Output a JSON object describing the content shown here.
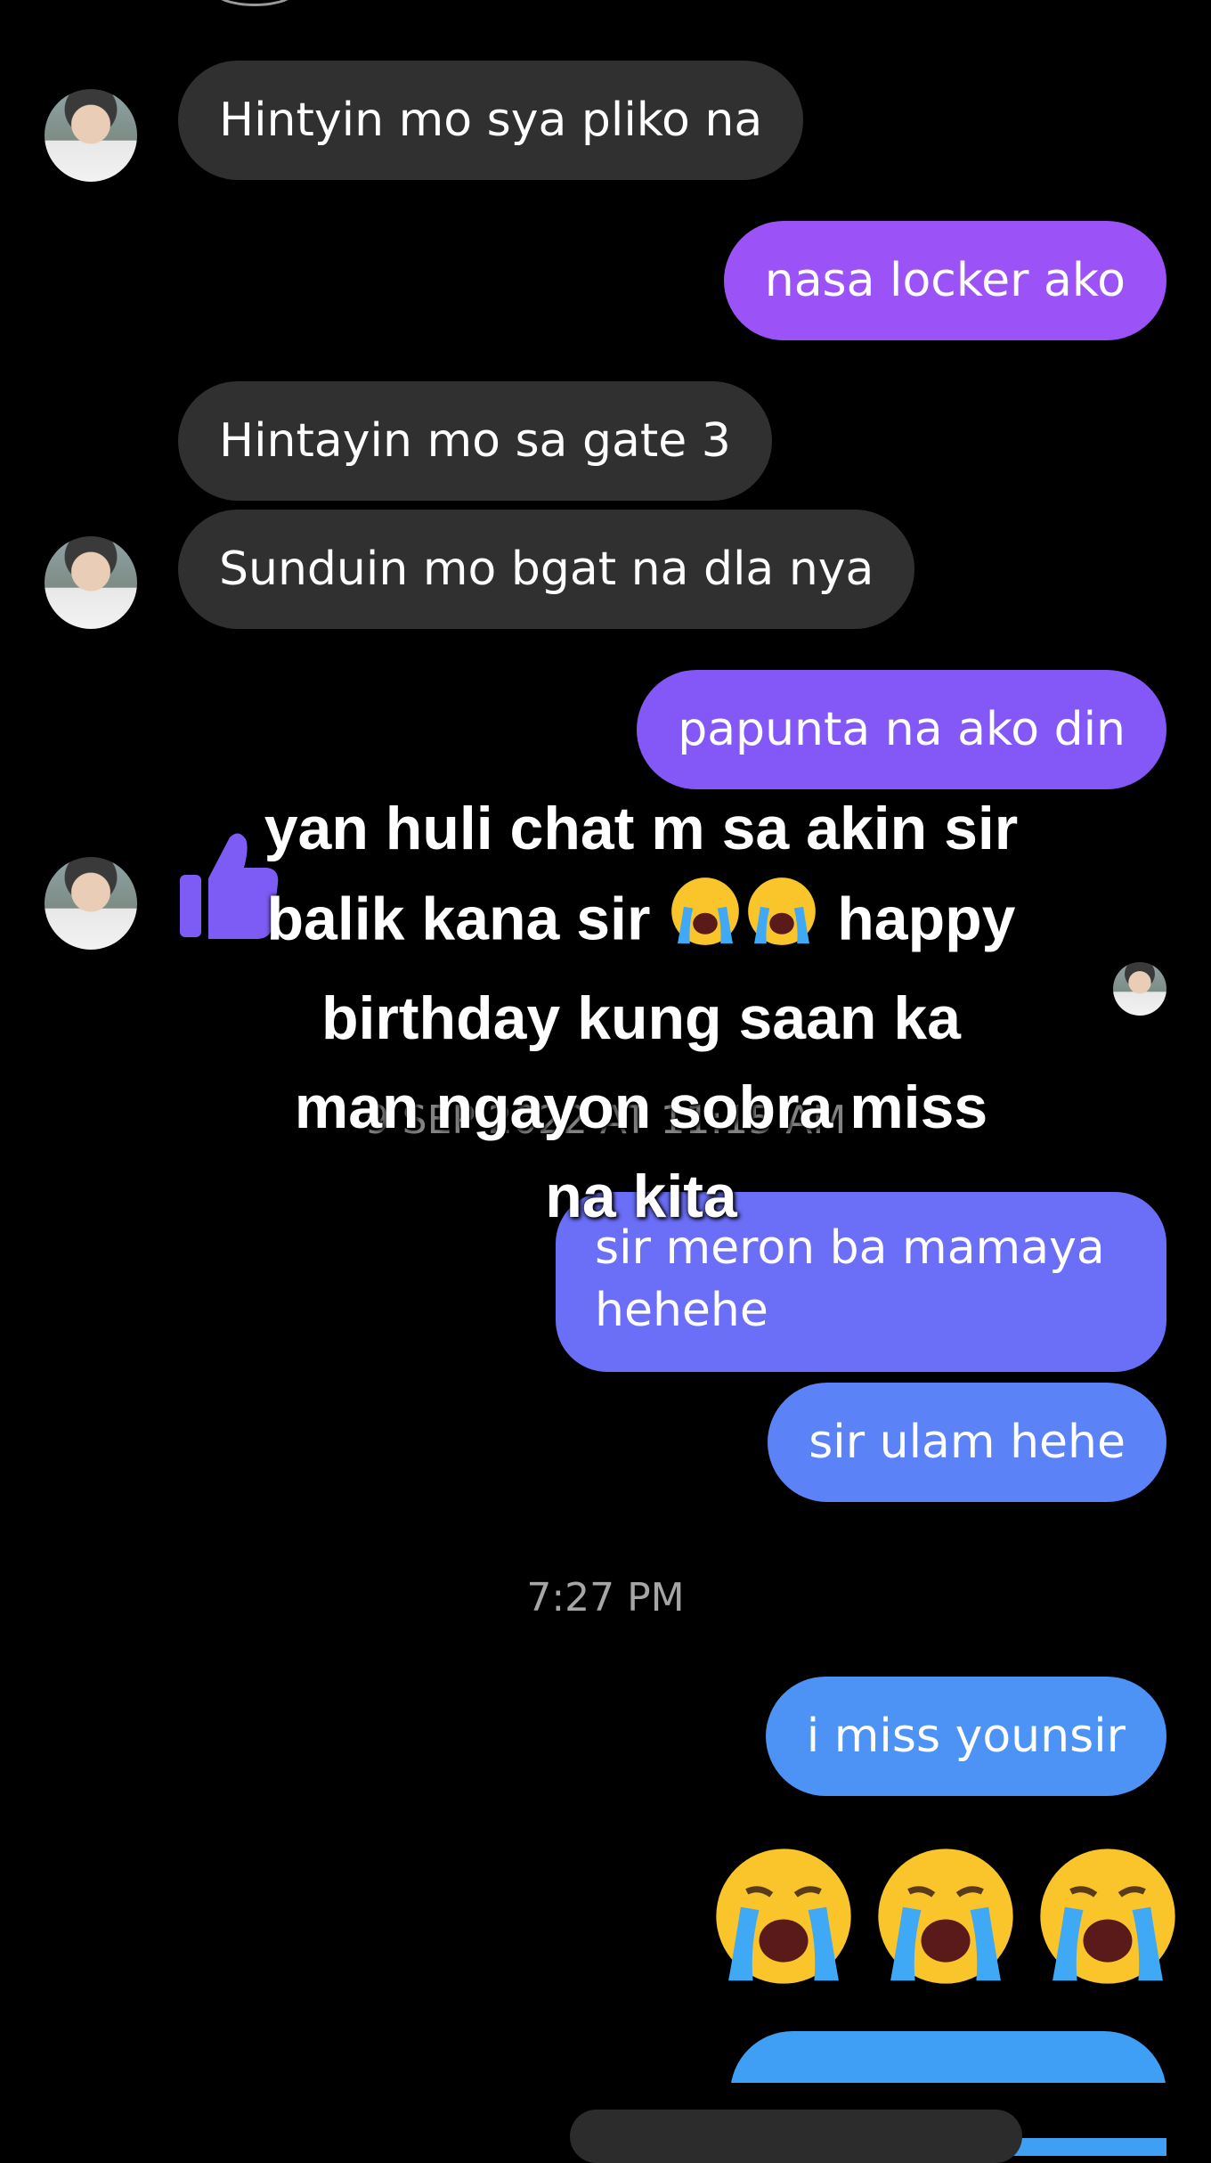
{
  "messages": {
    "m1": "Hintyin mo sya pliko na",
    "m2": "nasa locker ako",
    "m3": "Hintayin mo sa gate 3",
    "m4": "Sunduin mo bgat na dla nya",
    "m5": "papunta na ako din",
    "m6": "sir meron ba mamaya hehehe",
    "m7": "sir ulam hehe",
    "m8": "i miss younsir"
  },
  "timestamps": {
    "faded": "9 SEP 2022 AT 11:15 AM",
    "evening": "7:27 PM"
  },
  "overlay_caption": {
    "line1": "yan huli chat m sa akin sir",
    "line2a": "balik kana sir",
    "line2b": "happy",
    "line3": "birthday kung saan ka",
    "line4": "man ngayon sobra miss",
    "line5": "na kita"
  },
  "colors": {
    "incoming": "#303030",
    "outgoing_gradient": [
      "#9b53f7",
      "#8358f6",
      "#6b6ef6",
      "#5b82f6",
      "#4c93f5",
      "#3e9ff4"
    ]
  },
  "icons": [
    "avatar",
    "thumbs-up-icon",
    "crying-emoji-icon"
  ]
}
